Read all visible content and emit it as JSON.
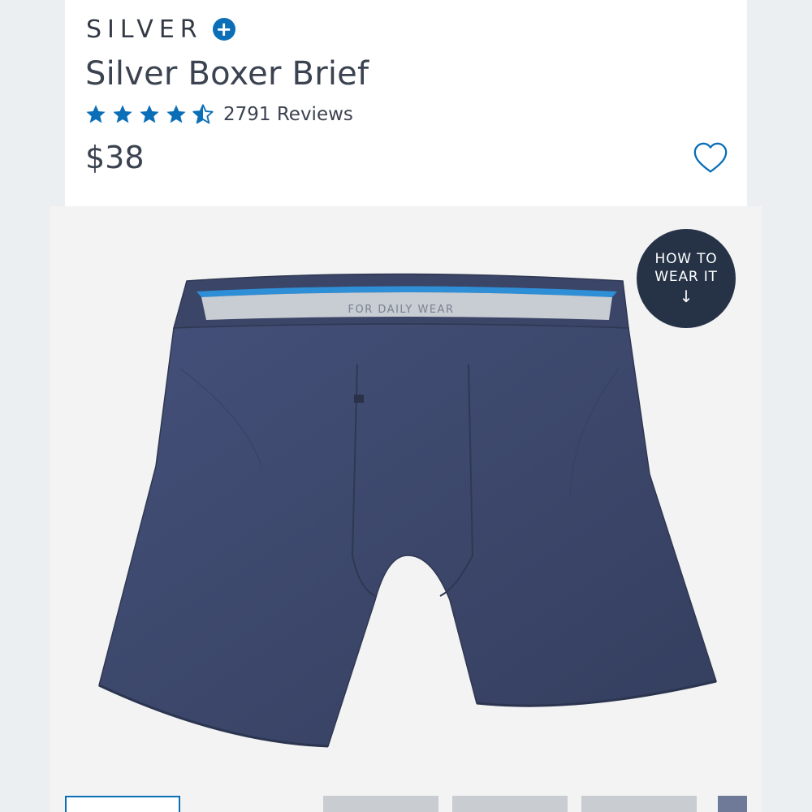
{
  "product": {
    "brand": "SILVER",
    "brand_badge": "+",
    "title": "Silver Boxer Brief",
    "rating": 4.5,
    "rating_max": 5,
    "reviews_label": "2791 Reviews",
    "price": "$38",
    "waistband_text": "FOR DAILY WEAR"
  },
  "badge": {
    "line1": "HOW TO",
    "line2": "WEAR IT",
    "arrow": "↓"
  },
  "icons": {
    "star": "star-icon",
    "half_star": "half-star-icon",
    "wishlist": "heart-icon",
    "brand_plus": "plus-icon"
  },
  "colors": {
    "accent": "#0a6fb7",
    "text": "#3b4250",
    "badge_bg": "#263347",
    "fabric": "#3e4868",
    "waistband_inner": "#2f8fd6"
  }
}
